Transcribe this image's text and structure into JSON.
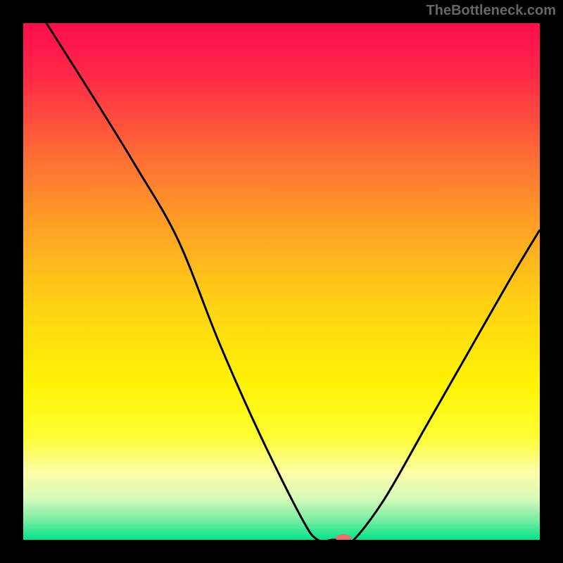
{
  "watermark": "TheBottleneck.com",
  "chart_data": {
    "type": "line",
    "title": "",
    "xlabel": "",
    "ylabel": "",
    "xlim": [
      0,
      100
    ],
    "ylim": [
      0,
      100
    ],
    "gradient_stops": [
      {
        "pos": 0.0,
        "color": "#ff0d4e"
      },
      {
        "pos": 0.1,
        "color": "#ff2748"
      },
      {
        "pos": 0.25,
        "color": "#ff6a36"
      },
      {
        "pos": 0.4,
        "color": "#ffa324"
      },
      {
        "pos": 0.55,
        "color": "#ffd313"
      },
      {
        "pos": 0.7,
        "color": "#fff304"
      },
      {
        "pos": 0.8,
        "color": "#fdfd32"
      },
      {
        "pos": 0.87,
        "color": "#fcfea8"
      },
      {
        "pos": 0.92,
        "color": "#d8f9ba"
      },
      {
        "pos": 0.96,
        "color": "#7beea5"
      },
      {
        "pos": 1.0,
        "color": "#05e288"
      }
    ],
    "series": [
      {
        "name": "bottleneck-curve",
        "x": [
          4.5,
          14,
          22,
          30,
          38,
          46,
          54,
          57,
          60,
          62,
          64,
          70,
          78,
          86,
          94,
          100
        ],
        "y": [
          100,
          85,
          72,
          58,
          38,
          20,
          4,
          0,
          0,
          0,
          0,
          8,
          22,
          36,
          50,
          60
        ]
      }
    ],
    "marker": {
      "x": 62,
      "y": 0,
      "color": "#e5716c",
      "rx": 11,
      "ry": 6
    }
  }
}
